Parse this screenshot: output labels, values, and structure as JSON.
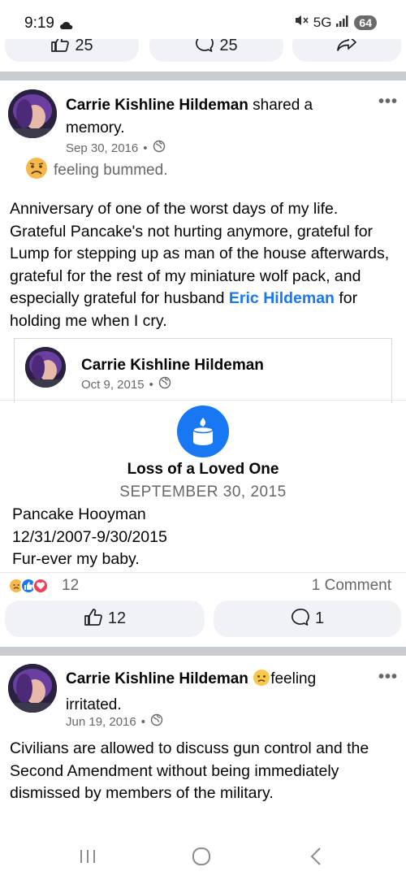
{
  "status": {
    "time": "9:19",
    "network": "5G",
    "battery": "64"
  },
  "top_actions": {
    "like_count": "25",
    "comment_count": "25"
  },
  "post1": {
    "author": "Carrie Kishline Hildeman",
    "action": " shared a memory.",
    "date": "Sep 30, 2016",
    "feeling": "feeling bummed.",
    "body_pre": "Anniversary of one of the worst days of my life. Grateful Pancake's not hurting anymore, grateful for Lump for stepping up as man of the house afterwards, grateful for the rest of my miniature wolf pack, and especially grateful for husband ",
    "body_link": "Eric Hildeman",
    "body_post": " for holding me when I cry.",
    "memory": {
      "author": "Carrie Kishline Hildeman",
      "date": "Oct 9, 2015",
      "event_title": "Loss of a Loved One",
      "event_date": "SEPTEMBER 30, 2015",
      "line1": "Pancake Hooyman",
      "line2": "12/31/2007-9/30/2015",
      "line3": "Fur-ever my baby."
    },
    "reaction_count": "12",
    "comments_label": "1 Comment",
    "like_count": "12",
    "comment_count": "1"
  },
  "post2": {
    "author": "Carrie Kishline Hildeman",
    "feeling": "feeling irritated.",
    "date": "Jun 19, 2016",
    "body": "Civilians are allowed to discuss gun control and the Second Amendment without being immediately dismissed by members of the military."
  },
  "colors": {
    "accent": "#1877f2",
    "divider": "#c9ccd1",
    "secondary_text": "#65676b"
  }
}
